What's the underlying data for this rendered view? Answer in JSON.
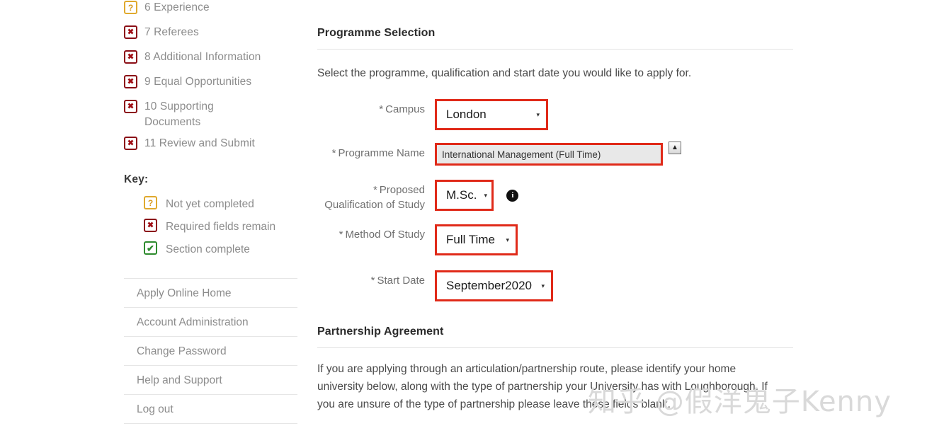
{
  "sidebar": {
    "progress_items": [
      {
        "status": "q",
        "label": "6 Experience"
      },
      {
        "status": "x",
        "label": "7 Referees"
      },
      {
        "status": "x",
        "label": "8 Additional Information"
      },
      {
        "status": "x",
        "label": "9 Equal Opportunities"
      },
      {
        "status": "x",
        "label": "10 Supporting Documents"
      },
      {
        "status": "x",
        "label": "11 Review and Submit"
      }
    ],
    "key_title": "Key:",
    "key_items": [
      {
        "status": "q",
        "label": "Not yet completed"
      },
      {
        "status": "x",
        "label": "Required fields remain"
      },
      {
        "status": "c",
        "label": "Section complete"
      }
    ],
    "nav_links": [
      "Apply Online Home",
      "Account Administration",
      "Change Password",
      "Help and Support",
      "Log out"
    ]
  },
  "main": {
    "programme_selection": {
      "title": "Programme Selection",
      "description": "Select the programme, qualification and start date you would like to apply for.",
      "fields": {
        "campus": {
          "label": "Campus",
          "required_mark": "*",
          "value": "London",
          "arrow": "▾"
        },
        "programme_name": {
          "label": "Programme Name",
          "required_mark": "*",
          "value": "International Management (Full Time)",
          "scroll_up": "▲"
        },
        "proposed_qualification": {
          "label_line1": "Proposed",
          "label_line2": "Qualification of Study",
          "required_mark": "*",
          "value": "M.Sc.",
          "arrow": "▾",
          "info_icon": "i"
        },
        "method_of_study": {
          "label": "Method Of Study",
          "required_mark": "*",
          "value": "Full Time",
          "arrow": "▾"
        },
        "start_date": {
          "label": "Start Date",
          "required_mark": "*",
          "value": "September2020",
          "arrow": "▾"
        }
      }
    },
    "partnership_agreement": {
      "title": "Partnership Agreement",
      "description": "If you are applying through an articulation/partnership route, please identify your home university below, along with the type of partnership your University has with Loughborough. If you are unsure of the type of partnership please leave these fields blank."
    }
  },
  "watermark": {
    "text": "知乎 @假洋鬼子Kenny"
  },
  "colors": {
    "accent_red": "#e02a19",
    "status_error": "#a00d14",
    "status_pending": "#d79a21",
    "status_complete": "#2e8b2e"
  }
}
